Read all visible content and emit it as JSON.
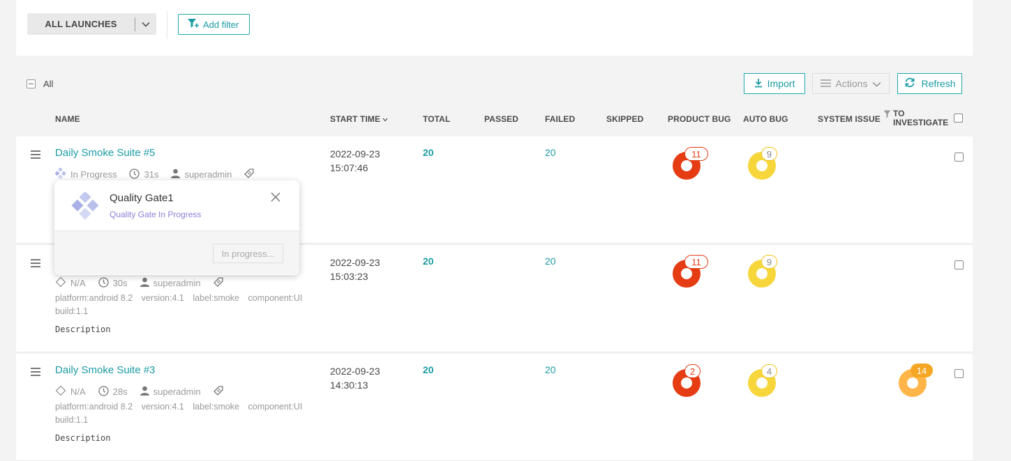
{
  "filter_bar": {
    "launches_dropdown_label": "ALL LAUNCHES",
    "add_filter_label": "Add filter"
  },
  "toolbar": {
    "select_all_label": "All",
    "import_label": "Import",
    "actions_label": "Actions",
    "refresh_label": "Refresh"
  },
  "columns": {
    "name": "NAME",
    "start_time": "START TIME",
    "total": "TOTAL",
    "passed": "PASSED",
    "failed": "FAILED",
    "skipped": "SKIPPED",
    "product_bug": "PRODUCT BUG",
    "auto_bug": "AUTO BUG",
    "system_issue": "SYSTEM ISSUE",
    "to_investigate_1": "TO",
    "to_investigate_2": "INVESTIGATE"
  },
  "launches": [
    {
      "name": "Daily Smoke Suite #5",
      "status": "In Progress",
      "duration": "31s",
      "owner": "superadmin",
      "date": "2022-09-23",
      "time": "15:07:46",
      "total": "20",
      "failed": "20",
      "product_bug": "11",
      "auto_bug": "9"
    },
    {
      "name": "",
      "status": "N/A",
      "duration": "30s",
      "owner": "superadmin",
      "attributes": [
        "platform:android 8.2",
        "version:4.1",
        "label:smoke",
        "component:UI",
        "build:1.1"
      ],
      "description": "Description",
      "date": "2022-09-23",
      "time": "15:03:23",
      "total": "20",
      "failed": "20",
      "product_bug": "11",
      "auto_bug": "9"
    },
    {
      "name": "Daily Smoke Suite #3",
      "status": "N/A",
      "duration": "28s",
      "owner": "superadmin",
      "attributes": [
        "platform:android 8.2",
        "version:4.1",
        "label:smoke",
        "component:UI",
        "build:1.1"
      ],
      "description": "Description",
      "date": "2022-09-23",
      "time": "14:30:13",
      "total": "20",
      "failed": "20",
      "product_bug": "2",
      "auto_bug": "4",
      "to_investigate": "14"
    }
  ],
  "quality_gate_popup": {
    "title": "Quality Gate1",
    "subtitle": "Quality Gate In Progress",
    "button_label": "In progress..."
  },
  "colors": {
    "accent": "#1a9ba4",
    "product_bug": "#e53c14",
    "auto_bug": "#f7d63c",
    "to_investigate": "#ffa940",
    "quality_gate": "#8b7fd6"
  }
}
